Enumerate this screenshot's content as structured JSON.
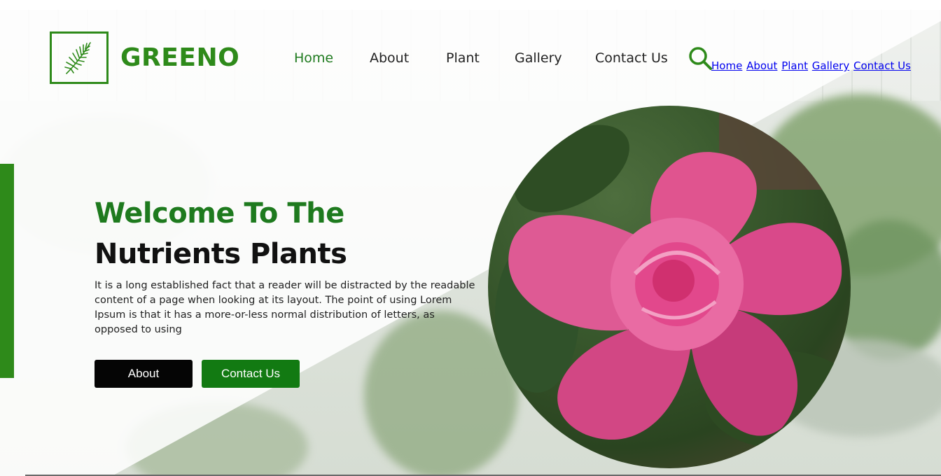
{
  "brand": {
    "name": "GREENO",
    "logo_icon": "palm-leaf-icon",
    "accent_color": "#2e8a1a"
  },
  "nav": {
    "items": [
      {
        "label": "Home",
        "active": true
      },
      {
        "label": "About",
        "active": false
      },
      {
        "label": "Plant",
        "active": false
      },
      {
        "label": "Gallery",
        "active": false
      },
      {
        "label": "Contact Us",
        "active": false
      }
    ],
    "search_icon": "search-icon"
  },
  "raw_links": [
    "Home",
    "About",
    "Plant",
    "Gallery",
    "Contact Us"
  ],
  "hero": {
    "title_green": "Welcome To The",
    "title_dark": "Nutrients Plants",
    "description": "It is a long established fact that a reader will be distracted by the readable content of a page when looking at its layout. The point of using Lorem Ipsum is that it has a more-or-less normal distribution of letters, as opposed to using",
    "about_button": "About",
    "contact_button": "Contact Us"
  },
  "colors": {
    "green": "#1e7a1e",
    "button_dark": "#050505",
    "button_green": "#127a12",
    "link_blue": "#0000ee"
  }
}
